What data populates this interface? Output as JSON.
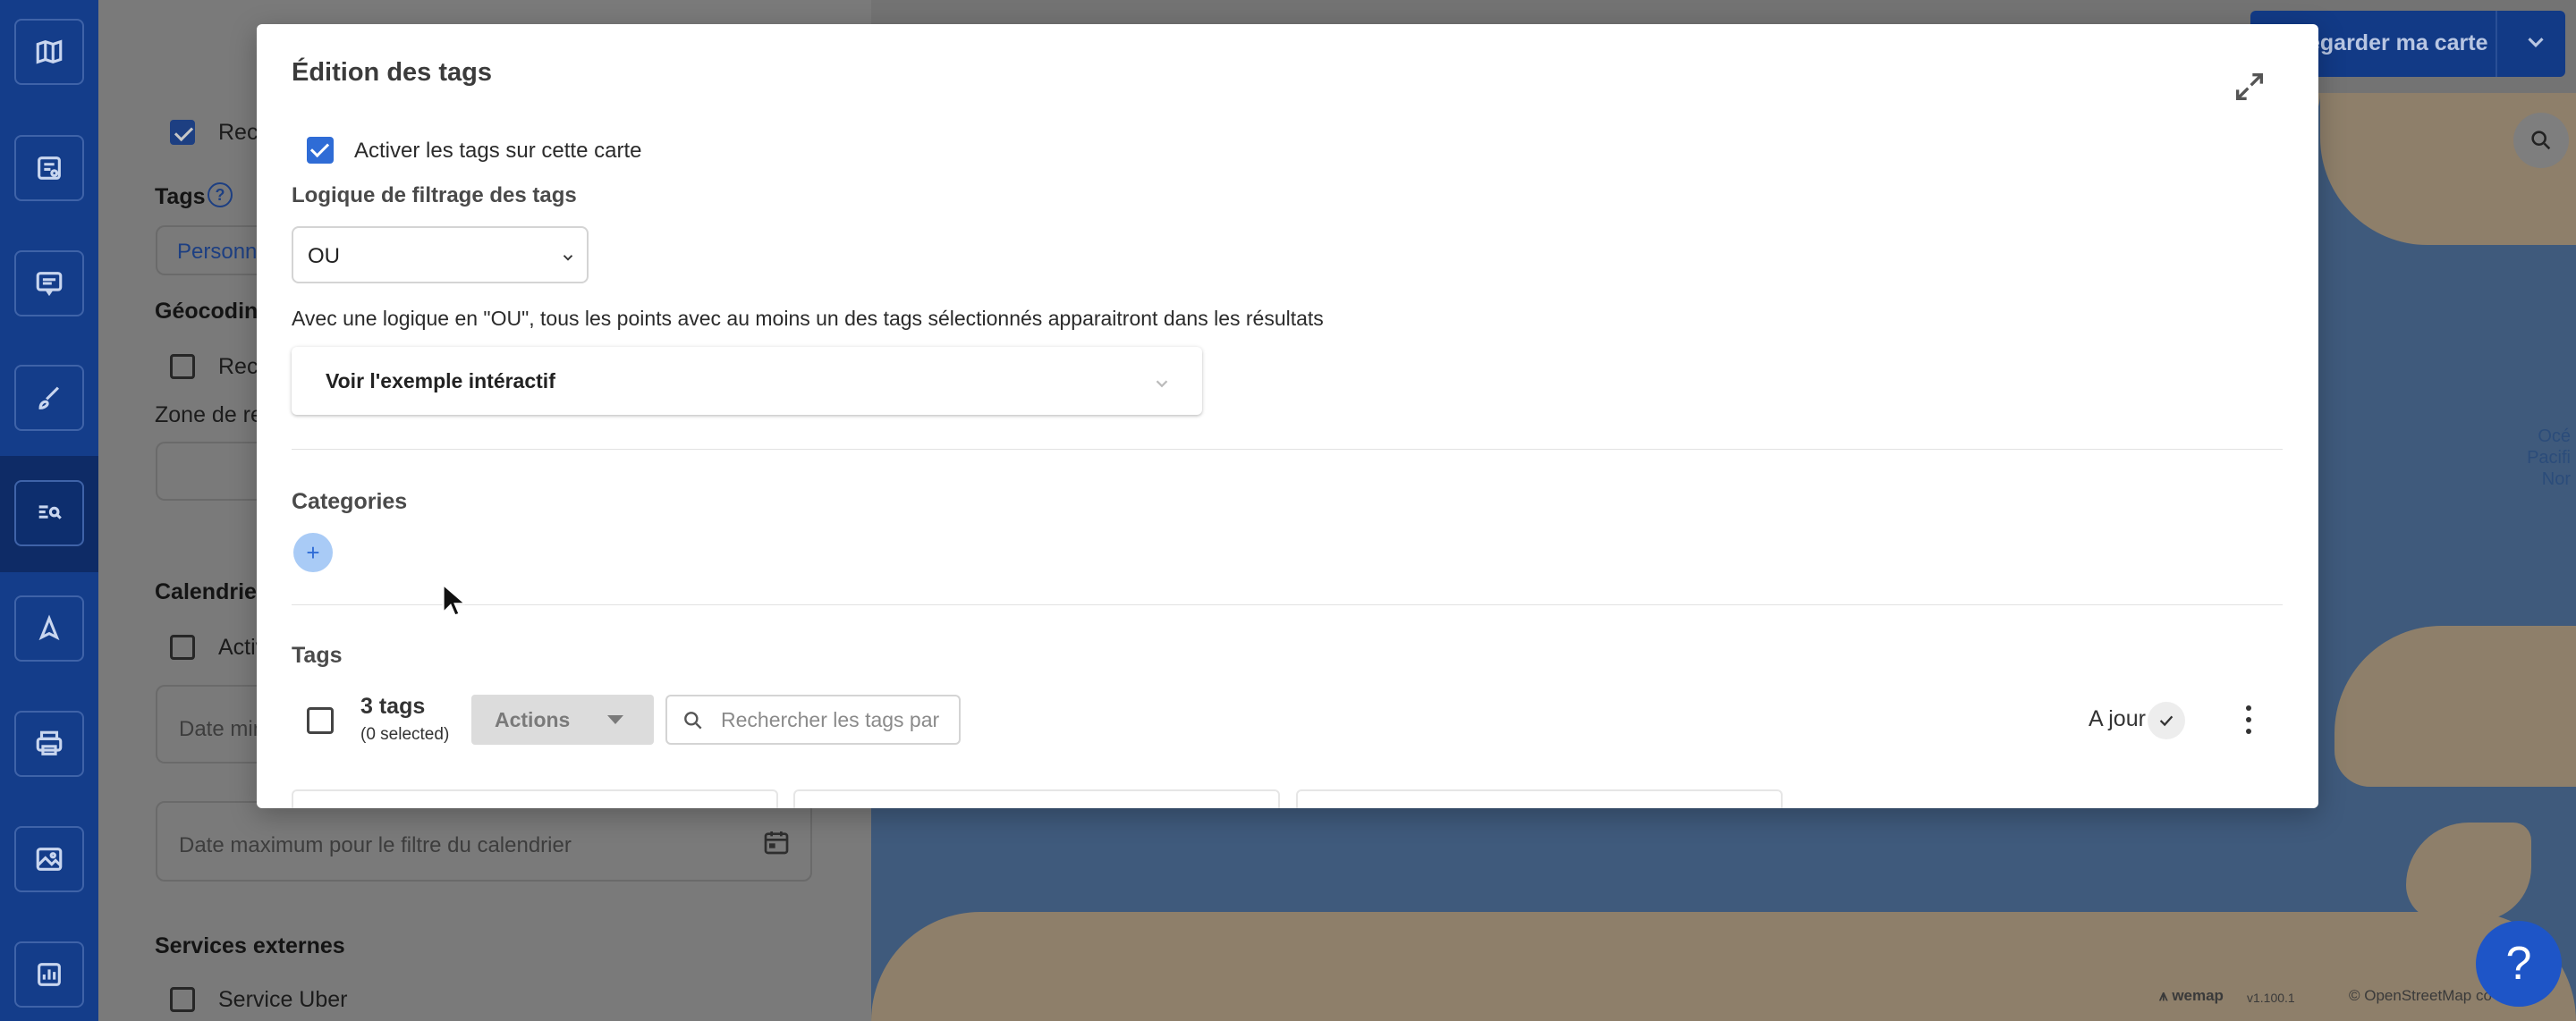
{
  "rail": {
    "icons": [
      "map-icon",
      "layers-icon",
      "popup-icon",
      "brush-icon",
      "search-list-icon",
      "navigation-icon",
      "print-icon",
      "image-map-icon",
      "stats-icon"
    ]
  },
  "panel": {
    "search_checkbox_label": "Rech",
    "tags_title": "Tags",
    "tags_button_label": "Personna",
    "geocoding_title": "Géocoding",
    "geocoding_checkbox_label": "Rech",
    "zone_label": "Zone de rec",
    "calendar_title": "Calendrier",
    "calendar_checkbox_label": "Activ",
    "date_min_placeholder": "Date min",
    "date_max_placeholder": "Date maximum pour le filtre du calendrier",
    "external_services_title": "Services externes",
    "uber_label": "Service Uber"
  },
  "map": {
    "save_button_label": "egarder ma carte",
    "ocean_label_lines": [
      "Océ",
      "Pacifi",
      "Nor"
    ],
    "attribution_brand": "wemap",
    "attribution_version": "v1.100.1",
    "attribution_osm": "© OpenStreetMap co"
  },
  "modal": {
    "title": "Édition des tags",
    "enable_tags_label": "Activer les tags sur cette carte",
    "enable_tags_checked": true,
    "filter_logic_title": "Logique de filtrage des tags",
    "filter_logic_value": "OU",
    "filter_logic_help": "Avec une logique en \"OU\", tous les points avec au moins un des tags sélectionnés apparaitront dans les résultats",
    "example_accordion_label": "Voir l'exemple intéractif",
    "categories_title": "Categories",
    "add_category_symbol": "+",
    "tags_title": "Tags",
    "tags_count": "3 tags",
    "tags_selected": "(0 selected)",
    "actions_label": "Actions",
    "search_placeholder": "Rechercher les tags par",
    "status_label": "A jour"
  },
  "help": {
    "symbol": "?"
  },
  "colors": {
    "accent": "#2f6cd6",
    "rail": "#143d8a",
    "save_button": "#123a86",
    "help_button": "#1e55c7"
  }
}
